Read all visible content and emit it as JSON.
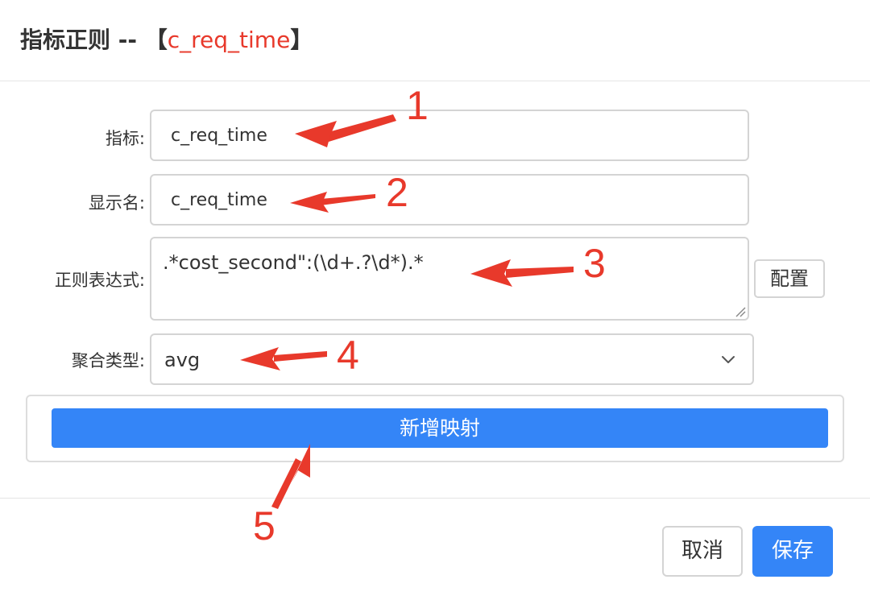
{
  "dialog": {
    "title_prefix": "指标正则 -- 【",
    "title_metric": "c_req_time",
    "title_suffix": "】"
  },
  "form": {
    "metric_label": "指标:",
    "metric_value": "c_req_time",
    "display_name_label": "显示名:",
    "display_name_value": "c_req_time",
    "regex_label": "正则表达式:",
    "regex_value": ".*cost_second\":(\\d+.?\\d*).*",
    "config_button": "配置",
    "aggregation_label": "聚合类型:",
    "aggregation_value": "avg",
    "add_mapping_button": "新增映射"
  },
  "footer": {
    "cancel_button": "取消",
    "save_button": "保存"
  },
  "annotations": {
    "color": "#e8392b",
    "labels": [
      "1",
      "2",
      "3",
      "4",
      "5"
    ]
  },
  "colors": {
    "primary": "#3485f7",
    "accent_red": "#e8392b"
  }
}
